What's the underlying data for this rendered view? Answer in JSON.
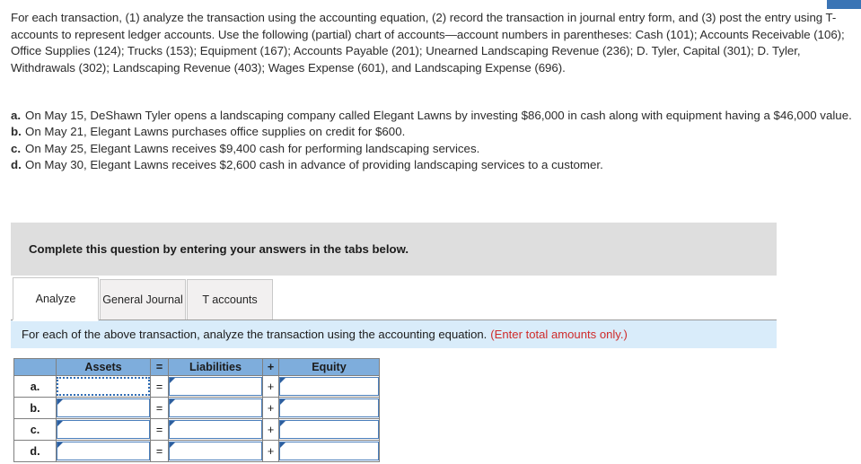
{
  "intro": {
    "paragraph": "For each transaction, (1) analyze the transaction using the accounting equation, (2) record the transaction in journal entry form, and (3) post the entry using T-accounts to represent ledger accounts. Use the following (partial) chart of accounts—account numbers in parentheses: Cash (101); Accounts Receivable (106); Office Supplies (124); Trucks (153); Equipment (167); Accounts Payable (201); Unearned Landscaping Revenue (236); D. Tyler, Capital (301); D. Tyler, Withdrawals (302); Landscaping Revenue (403); Wages Expense (601), and Landscaping Expense (696)."
  },
  "transactions": [
    {
      "marker": "a.",
      "text": "On May 15, DeShawn Tyler opens a landscaping company called Elegant Lawns by investing $86,000 in cash along with equipment having a $46,000 value."
    },
    {
      "marker": "b.",
      "text": "On May 21, Elegant Lawns purchases office supplies on credit for $600."
    },
    {
      "marker": "c.",
      "text": "On May 25, Elegant Lawns receives $9,400 cash for performing landscaping services."
    },
    {
      "marker": "d.",
      "text": "On May 30, Elegant Lawns receives $2,600 cash in advance of providing landscaping services to a customer."
    }
  ],
  "banner": {
    "text": "Complete this question by entering your answers in the tabs below."
  },
  "tabs": [
    {
      "label": "Analyze",
      "active": true
    },
    {
      "label": "General Journal",
      "active": false
    },
    {
      "label": "T accounts",
      "active": false
    }
  ],
  "instruction": {
    "text": "For each of the above transaction, analyze the transaction using the accounting equation.",
    "note": "(Enter total amounts only.)",
    "note_color": "#cf2b2b"
  },
  "table": {
    "headers": [
      "",
      "Assets",
      "=",
      "Liabilities",
      "+",
      "Equity"
    ],
    "header_bg": "#7eaddc",
    "rows": [
      {
        "label": "a.",
        "assets": "",
        "eq": "=",
        "liabilities": "",
        "plus": "+",
        "equity": "",
        "focused": "assets"
      },
      {
        "label": "b.",
        "assets": "",
        "eq": "=",
        "liabilities": "",
        "plus": "+",
        "equity": "",
        "focused": ""
      },
      {
        "label": "c.",
        "assets": "",
        "eq": "=",
        "liabilities": "",
        "plus": "+",
        "equity": "",
        "focused": ""
      },
      {
        "label": "d.",
        "assets": "",
        "eq": "=",
        "liabilities": "",
        "plus": "+",
        "equity": "",
        "focused": ""
      }
    ]
  }
}
